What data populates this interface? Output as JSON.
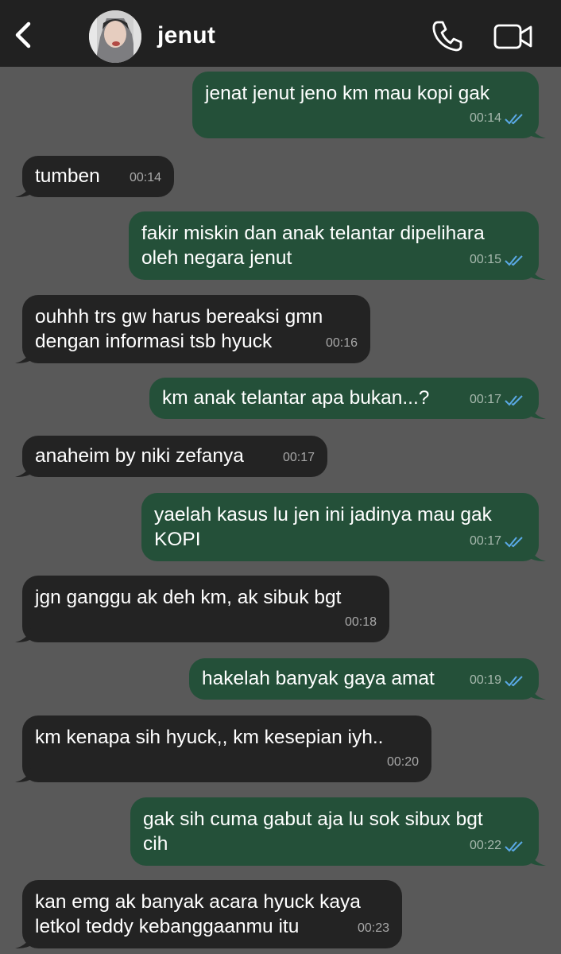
{
  "header": {
    "contact_name": "jenut"
  },
  "colors": {
    "header_bg": "#212121",
    "chat_bg": "#595959",
    "incoming_bubble": "#232323",
    "outgoing_bubble": "#245039",
    "read_ticks": "#5aa9e6"
  },
  "icons": {
    "back": "chevron-left-icon",
    "call": "phone-icon",
    "video": "video-camera-icon",
    "read": "double-check-icon"
  },
  "messages": [
    {
      "dir": "out",
      "text": "jenat jenut jeno km mau kopi gak",
      "time": "00:14",
      "read": true
    },
    {
      "dir": "in",
      "text": "tumben",
      "time": "00:14"
    },
    {
      "dir": "out",
      "text": "fakir miskin dan anak telantar dipelihara\noleh negara jenut",
      "time": "00:15",
      "read": true
    },
    {
      "dir": "in",
      "text": "ouhhh trs gw harus bereaksi gmn\ndengan informasi tsb hyuck",
      "time": "00:16"
    },
    {
      "dir": "out",
      "text": "km anak telantar apa bukan...?",
      "time": "00:17",
      "read": true
    },
    {
      "dir": "in",
      "text": "anaheim by niki zefanya",
      "time": "00:17"
    },
    {
      "dir": "out",
      "text": "yaelah kasus lu jen ini jadinya mau gak\nKOPI",
      "time": "00:17",
      "read": true
    },
    {
      "dir": "in",
      "text": "jgn ganggu ak deh km, ak sibuk bgt",
      "time": "00:18"
    },
    {
      "dir": "out",
      "text": "hakelah banyak gaya amat",
      "time": "00:19",
      "read": true
    },
    {
      "dir": "in",
      "text": "km kenapa sih hyuck,, km kesepian iyh..",
      "time": "00:20"
    },
    {
      "dir": "out",
      "text": "gak sih cuma gabut aja lu sok sibux bgt\ncih",
      "time": "00:22",
      "read": true
    },
    {
      "dir": "in",
      "text": "kan emg ak banyak acara hyuck kaya\nletkol teddy kebanggaanmu itu",
      "time": "00:23"
    }
  ]
}
